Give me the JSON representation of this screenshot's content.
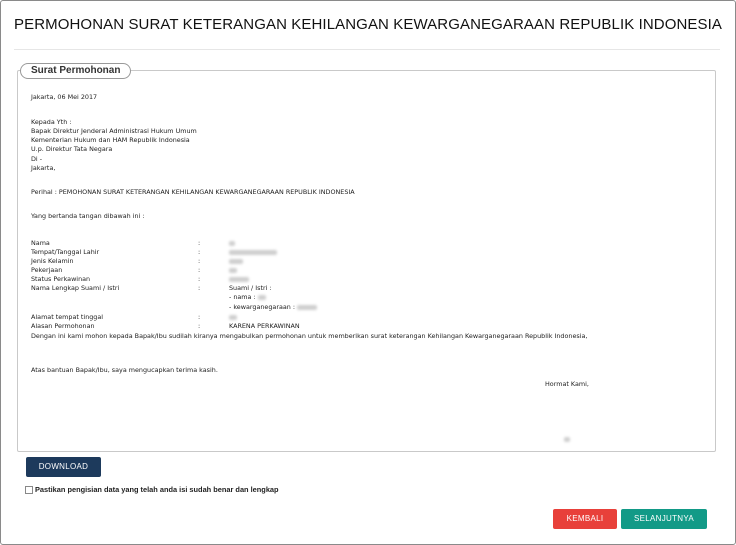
{
  "page": {
    "title": "PERMOHONAN SURAT KETERANGAN KEHILANGAN KEWARGANEGARAAN REPUBLIK INDONESIA"
  },
  "letter": {
    "legend": "Surat Permohonan",
    "date_line": "Jakarta, 06 Mei 2017",
    "recipient": [
      "Kepada Yth :",
      "Bapak Direktur Jenderal Administrasi Hukum Umum",
      "Kementerian Hukum dan HAM Republik Indonesia",
      "U.p. Direktur Tata Negara",
      "Di -",
      "Jakarta,"
    ],
    "perihal": "Perihal : PEMOHONAN SURAT KETERANGAN KEHILANGAN KEWARGANEGARAAN REPUBLIK INDONESIA",
    "intro": "Yang bertanda tangan dibawah ini :",
    "fields": {
      "colon": ":",
      "nama": "Nama",
      "ttl": "Tempat/Tanggal Lahir",
      "jk": "Jenis Kelamin",
      "pekerjaan": "Pekerjaan",
      "status": "Status Perkawinan",
      "pasangan": "Nama Lengkap Suami / Istri",
      "pasangan_head": "Suami / Istri :",
      "pasangan_nama": "- nama :",
      "pasangan_kewarganegaraan": "- kewarganegaraan :",
      "alamat": "Alamat tempat tinggal",
      "alasan": "Alasan Permohonan",
      "alasan_value": "KARENA PERKAWINAN"
    },
    "request": "Dengan ini kami mohon kepada Bapak/Ibu sudilah kiranya mengabulkan permohonan untuk memberikan surat keterangan Kehilangan Kewarganegaraan Republik Indonesia,",
    "closing": "Atas bantuan Bapak/Ibu, saya mengucapkan terima kasih.",
    "signoff": "Hormat Kami,"
  },
  "actions": {
    "download": "DOWNLOAD",
    "confirm": "Pastikan pengisian data yang telah anda isi sudah benar dan lengkap",
    "back": "KEMBALI",
    "next": "SELANJUTNYA"
  }
}
